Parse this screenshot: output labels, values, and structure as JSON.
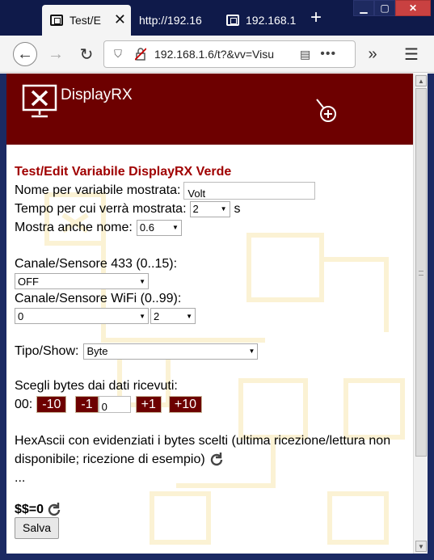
{
  "browser": {
    "tabs": [
      {
        "label": "Test/E",
        "active": true
      },
      {
        "label": "http://192.16",
        "active": false
      },
      {
        "label": "192.168.1",
        "active": false
      }
    ],
    "url": "192.168.1.6/t?&vv=Visu"
  },
  "app": {
    "brand": "DisplayRX"
  },
  "form": {
    "title": "Test/Edit Variabile DisplayRX Verde",
    "name_label": "Nome per variabile mostrata:",
    "name_value": "Volt",
    "time_label": "Tempo per cui verrà mostrata:",
    "time_value": "2",
    "time_unit": "s",
    "show_name_label": "Mostra anche nome:",
    "show_name_value": "0.6",
    "channel433_label": "Canale/Sensore 433 (0..15):",
    "channel433_value": "OFF",
    "wifi_label": "Canale/Sensore WiFi (0..99):",
    "wifi_value": "0",
    "wifi_sub_value": "2",
    "type_label": "Tipo/Show:",
    "type_value": "Byte",
    "bytes_label": "Scegli bytes dai dati ricevuti:",
    "byte_index": "00:",
    "btn_minus10": "-10",
    "btn_minus1": "-1",
    "byte_value": "0",
    "btn_plus1": "+1",
    "btn_plus10": "+10",
    "hex_text": "HexAscii con evidenziati i bytes scelti (ultima ricezione/lettura non disponibile; ricezione di esempio)",
    "ellipsis": "...",
    "result": "$$=0",
    "save": "Salva"
  },
  "colors": {
    "header": "#6d0000",
    "title": "#a00000",
    "titlebar": "#0f1a4a"
  }
}
